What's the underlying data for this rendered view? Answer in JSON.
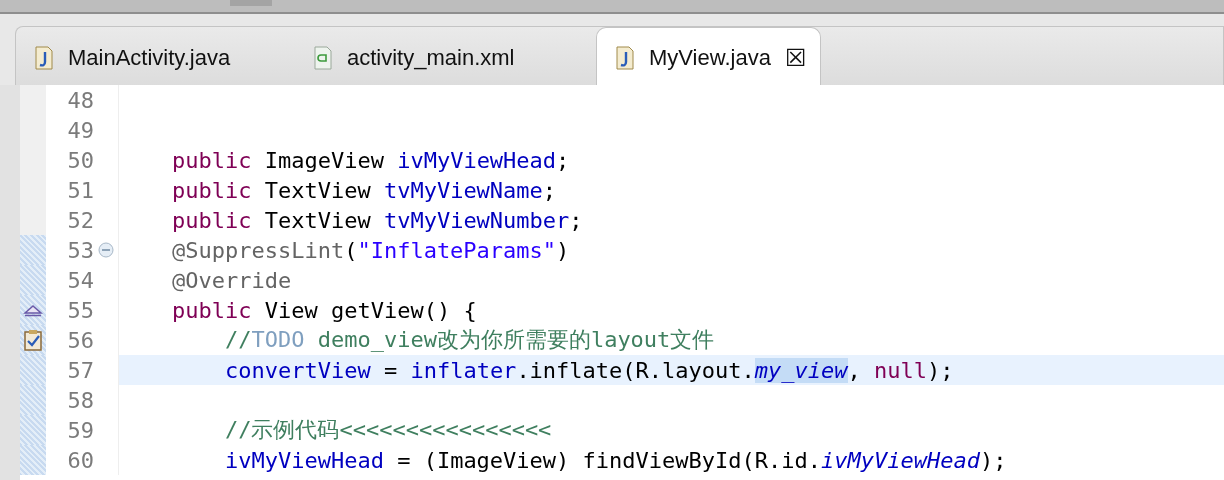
{
  "tabs": [
    {
      "label": "MainActivity.java",
      "kind": "java",
      "selected": false
    },
    {
      "label": "activity_main.xml",
      "kind": "xml",
      "selected": false
    },
    {
      "label": "MyView.java",
      "kind": "java",
      "selected": true
    }
  ],
  "close_glyph": "☒",
  "lines": [
    {
      "number": "48",
      "kind": "code",
      "in_range": false,
      "current": false
    },
    {
      "number": "49",
      "kind": "code",
      "in_range": false,
      "current": false
    },
    {
      "number": "50",
      "kind": "code",
      "in_range": false,
      "current": false,
      "tokens": [
        {
          "kind": "keyword",
          "text": "public"
        },
        {
          "kind": "plain",
          "text": " ImageView "
        },
        {
          "kind": "field",
          "text": "ivMyViewHead"
        },
        {
          "kind": "plain",
          "text": ";"
        }
      ]
    },
    {
      "number": "51",
      "kind": "code",
      "in_range": false,
      "current": false,
      "tokens": [
        {
          "kind": "keyword",
          "text": "public"
        },
        {
          "kind": "plain",
          "text": " TextView "
        },
        {
          "kind": "field",
          "text": "tvMyViewName"
        },
        {
          "kind": "plain",
          "text": ";"
        }
      ]
    },
    {
      "number": "52",
      "kind": "code",
      "in_range": false,
      "current": false,
      "tokens": [
        {
          "kind": "keyword",
          "text": "public"
        },
        {
          "kind": "plain",
          "text": " TextView "
        },
        {
          "kind": "field",
          "text": "tvMyViewNumber"
        },
        {
          "kind": "plain",
          "text": ";"
        }
      ]
    },
    {
      "number": "53",
      "kind": "fold",
      "in_range": true,
      "current": false,
      "tokens": [
        {
          "kind": "annotation",
          "text": "@SuppressLint"
        },
        {
          "kind": "plain",
          "text": "("
        },
        {
          "kind": "string",
          "text": "\"InflateParams\""
        },
        {
          "kind": "plain",
          "text": ")"
        }
      ]
    },
    {
      "number": "54",
      "kind": "code",
      "in_range": true,
      "current": false,
      "tokens": [
        {
          "kind": "annotation",
          "text": "@Override"
        }
      ]
    },
    {
      "number": "55",
      "kind": "override",
      "in_range": true,
      "current": false,
      "tokens": [
        {
          "kind": "keyword",
          "text": "public"
        },
        {
          "kind": "plain",
          "text": " View getView() {"
        }
      ],
      "children": [
        {
          "number": "56",
          "kind": "task",
          "in_range": true,
          "current": false,
          "tokens": [
            {
              "kind": "comment",
              "text": "//"
            },
            {
              "kind": "todo",
              "text": "TODO"
            },
            {
              "kind": "comment",
              "text": " demo_view改为你所需要的layout文件"
            }
          ]
        },
        {
          "number": "57",
          "kind": "code",
          "in_range": true,
          "current": true,
          "tokens": [
            {
              "kind": "field",
              "text": "convertView"
            },
            {
              "kind": "plain",
              "text": " = "
            },
            {
              "kind": "field",
              "text": "inflater"
            },
            {
              "kind": "plain",
              "text": ".inflate(R.layout."
            },
            {
              "kind": "static",
              "text": "my_view",
              "highlighted": true
            },
            {
              "kind": "plain",
              "text": ", "
            },
            {
              "kind": "keyword",
              "text": "null"
            },
            {
              "kind": "plain",
              "text": ");"
            }
          ]
        },
        {
          "number": "58",
          "kind": "code",
          "in_range": true,
          "current": false
        },
        {
          "number": "59",
          "kind": "code",
          "in_range": true,
          "current": false,
          "tokens": [
            {
              "kind": "comment",
              "text": "//示例代码<<<<<<<<<<<<<<<<"
            }
          ]
        },
        {
          "number": "60",
          "kind": "code",
          "in_range": true,
          "current": false,
          "tokens": [
            {
              "kind": "field",
              "text": "ivMyViewHead"
            },
            {
              "kind": "plain",
              "text": " = (ImageView) findViewById(R.id."
            },
            {
              "kind": "static",
              "text": "ivMyViewHead"
            },
            {
              "kind": "plain",
              "text": ");"
            }
          ]
        }
      ]
    }
  ]
}
